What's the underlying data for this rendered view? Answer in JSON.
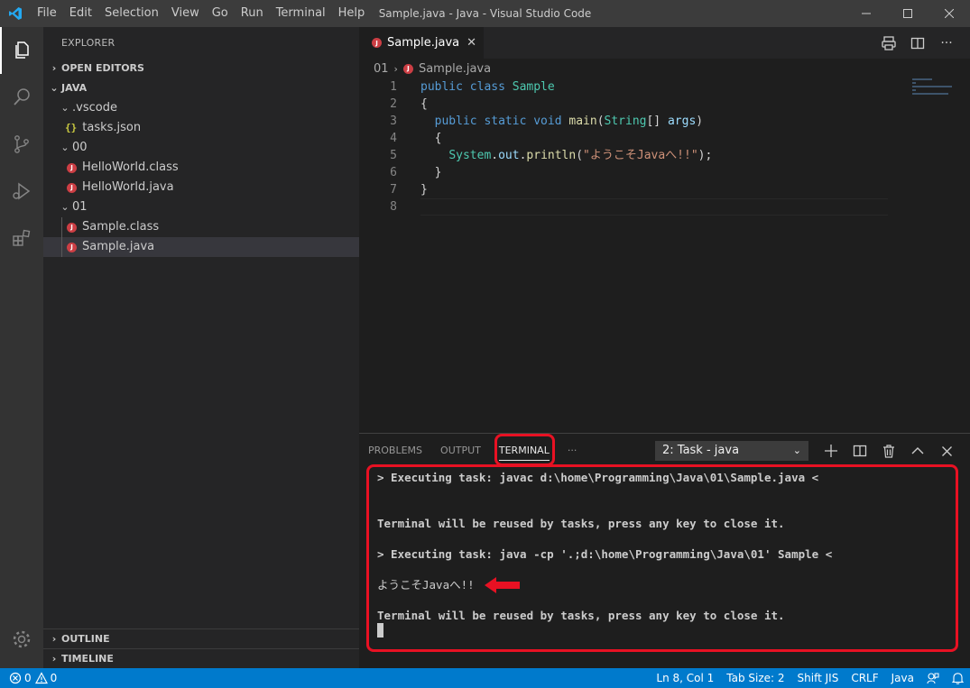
{
  "titlebar": {
    "window_title": "Sample.java - Java - Visual Studio Code",
    "menu": [
      "File",
      "Edit",
      "Selection",
      "View",
      "Go",
      "Run",
      "Terminal",
      "Help"
    ]
  },
  "sidebar": {
    "title": "EXPLORER",
    "open_editors": "OPEN EDITORS",
    "folder": "JAVA",
    "tree": [
      {
        "label": ".vscode",
        "type": "folder"
      },
      {
        "label": "tasks.json",
        "type": "json"
      },
      {
        "label": "00",
        "type": "folder"
      },
      {
        "label": "HelloWorld.class",
        "type": "java"
      },
      {
        "label": "HelloWorld.java",
        "type": "java"
      },
      {
        "label": "01",
        "type": "folder"
      },
      {
        "label": "Sample.class",
        "type": "java"
      },
      {
        "label": "Sample.java",
        "type": "java",
        "selected": true
      }
    ],
    "outline": "OUTLINE",
    "timeline": "TIMELINE"
  },
  "editor": {
    "tab_label": "Sample.java",
    "breadcrumb": {
      "folder": "01",
      "file": "Sample.java"
    },
    "line_numbers": [
      "1",
      "2",
      "3",
      "4",
      "5",
      "6",
      "7",
      "8"
    ],
    "code": {
      "l1_kw": "public class ",
      "l1_ty": "Sample",
      "l2": "{",
      "l3_kw": "  public static void ",
      "l3_fn": "main",
      "l3_p1": "(",
      "l3_ty": "String",
      "l3_p2": "[] ",
      "l3_var": "args",
      "l3_p3": ")",
      "l4": "  {",
      "l5_ind": "    ",
      "l5_ty": "System",
      "l5_dot1": ".",
      "l5_var": "out",
      "l5_dot2": ".",
      "l5_fn": "println",
      "l5_p1": "(",
      "l5_str": "\"ようこそJavaへ!!\"",
      "l5_p2": ");",
      "l6": "  }",
      "l7": "}"
    }
  },
  "panel": {
    "tabs": [
      "PROBLEMS",
      "OUTPUT",
      "TERMINAL"
    ],
    "more": "···",
    "terminal_select": "2: Task - java",
    "lines": [
      "> Executing task: javac d:\\home\\Programming\\Java\\01\\Sample.java <",
      "",
      "",
      "Terminal will be reused by tasks, press any key to close it.",
      "",
      "> Executing task: java -cp '.;d:\\home\\Programming\\Java\\01' Sample <",
      "",
      "ようこそJavaへ!!",
      "",
      "Terminal will be reused by tasks, press any key to close it."
    ]
  },
  "statusbar": {
    "errors": "0",
    "warnings": "0",
    "position": "Ln 8, Col 1",
    "tab_size": "Tab Size: 2",
    "encoding": "Shift JIS",
    "eol": "CRLF",
    "language": "Java"
  },
  "colors": {
    "accent": "#007acc",
    "highlight": "#e81123",
    "java_icon": "#cc3e44"
  }
}
